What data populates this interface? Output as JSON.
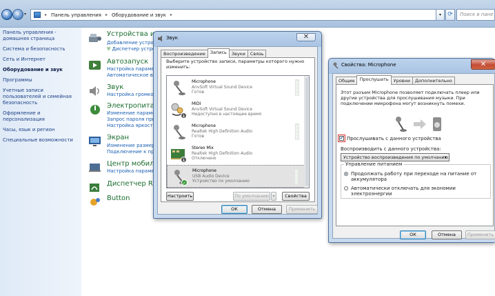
{
  "explorer": {
    "breadcrumb": [
      "Панель управления",
      "Оборудование и звук"
    ],
    "search_placeholder": "Поиск в пане"
  },
  "leftnav": {
    "items": [
      {
        "label": "Панель управления - домашняя страница"
      },
      {
        "label": "Система и безопасность"
      },
      {
        "label": "Сеть и Интернет"
      },
      {
        "label": "Оборудование и звук",
        "current": true
      },
      {
        "label": "Программы"
      },
      {
        "label": "Учетные записи пользователей и семейная безопасность"
      },
      {
        "label": "Оформление и персонализация"
      },
      {
        "label": "Часы, язык и регион"
      },
      {
        "label": "Специальные возможности"
      }
    ]
  },
  "categories": [
    {
      "title": "Устройства и пр",
      "links": [
        "Добавление устрой",
        "Диспетчер устрой"
      ],
      "icon": "devices-icon"
    },
    {
      "title": "Автозапуск",
      "links": [
        "Настройка параметр",
        "Автоматическое вос"
      ],
      "icon": "autoplay-icon"
    },
    {
      "title": "Звук",
      "links": [
        "Настройка громкост"
      ],
      "icon": "sound-icon"
    },
    {
      "title": "Электропитание",
      "links": [
        "Изменение параметр",
        "Запрос пароля при в",
        "Настройка яркости э"
      ],
      "icon": "power-icon"
    },
    {
      "title": "Экран",
      "links": [
        "Изменение размеров",
        "Подключение к прое"
      ],
      "icon": "display-icon"
    },
    {
      "title": "Центр мобильно",
      "links": [
        "Настройка параметр"
      ],
      "icon": "mobility-icon"
    },
    {
      "title": "Диспетчер Realt",
      "links": [],
      "icon": "realtek-icon"
    },
    {
      "title": "Button",
      "links": [],
      "icon": "button-icon"
    }
  ],
  "sound_dialog": {
    "title": "Звук",
    "tabs": [
      "Воспроизведение",
      "Запись",
      "Звуки",
      "Связь"
    ],
    "selected_tab": 1,
    "instruction": "Выберите устройство записи, параметры которого нужно изменить:",
    "devices": [
      {
        "name": "Microphone",
        "driver": "AnvSoft Virtual Sound Device",
        "status": "Готов",
        "badge": ""
      },
      {
        "name": "MIDI",
        "driver": "AnvSoft Virtual Sound Device",
        "status": "Недоступно в настоящее время",
        "badge": "down"
      },
      {
        "name": "Microphone",
        "driver": "Realtek High Definition Audio",
        "status": "Готов",
        "badge": ""
      },
      {
        "name": "Stereo Mix",
        "driver": "Realtek High Definition Audio",
        "status": "Отключено",
        "badge": "down"
      },
      {
        "name": "Microphone",
        "driver": "USB Audio Device",
        "status": "Устройство по умолчанию",
        "badge": "ok",
        "selected": true
      }
    ],
    "configure_button": "Настроить",
    "default_button": "По умолчанию",
    "properties_button": "Свойства",
    "ok_button": "ОК",
    "cancel_button": "Отмена",
    "apply_button": "Применить"
  },
  "props_dialog": {
    "title": "Свойства: Microphone",
    "tabs": [
      "Общие",
      "Прослушать",
      "Уровни",
      "Дополнительно"
    ],
    "selected_tab": 1,
    "description": "Этот разъем Microphone позволяет подключать плеер или другие устройства для прослушивания музыки. При подключении микрофона могут возникнуть помехи.",
    "listen_checkbox": "Прослушивать с данного устройства",
    "listen_checked": true,
    "playback_label": "Воспроизводить с данного устройства:",
    "playback_select": "Устройство воспроизведения по умолчанию",
    "power_group": "Управление питанием",
    "power_options": [
      "Продолжать работу при переходе на питание от аккумулятора",
      "Автоматически отключать для экономии электроэнергии"
    ],
    "power_selected": 0,
    "ok_button": "ОК",
    "cancel_button": "Отмена",
    "apply_button": "Применить",
    "highlight_color": "#d9302a"
  }
}
